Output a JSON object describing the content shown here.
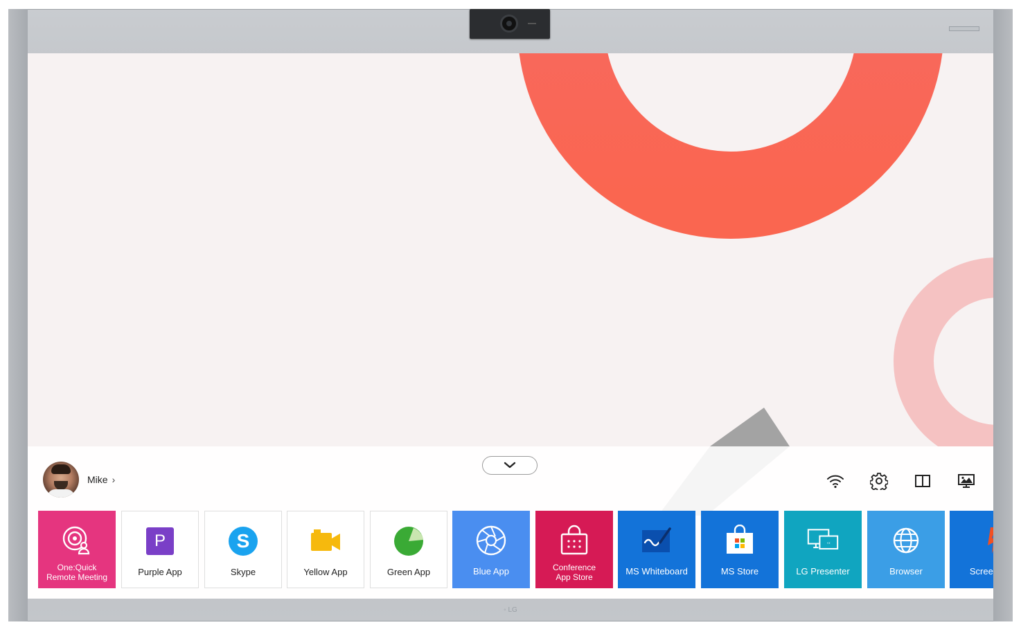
{
  "user": {
    "name": "Mike",
    "chevron": "›"
  },
  "status_icons": [
    {
      "name": "wifi-icon"
    },
    {
      "name": "settings-icon"
    },
    {
      "name": "split-screen-icon"
    },
    {
      "name": "screen-share-icon"
    }
  ],
  "apps": [
    {
      "label": "One:Quick Remote Meeting",
      "line1": "One:Quick",
      "line2": "Remote Meeting",
      "color": "#e5357f",
      "icon": "meeting-icon"
    },
    {
      "label": "Purple App",
      "color": "#ffffff",
      "icon": "purple-p-icon",
      "icon_text": "P"
    },
    {
      "label": "Skype",
      "color": "#ffffff",
      "icon": "skype-icon",
      "icon_text": "S"
    },
    {
      "label": "Yellow App",
      "color": "#ffffff",
      "icon": "video-camera-icon"
    },
    {
      "label": "Green App",
      "color": "#ffffff",
      "icon": "green-circle-icon"
    },
    {
      "label": "Blue App",
      "color": "#4a8ef0",
      "icon": "aperture-icon"
    },
    {
      "label": "Conference App Store",
      "line1": "Conference",
      "line2": "App Store",
      "color": "#d61a55",
      "icon": "shopping-bag-icon"
    },
    {
      "label": "MS Whiteboard",
      "color": "#1373d9",
      "icon": "whiteboard-icon"
    },
    {
      "label": "MS Store",
      "color": "#1373d9",
      "icon": "ms-store-icon"
    },
    {
      "label": "LG Presenter",
      "color": "#10a5c0",
      "icon": "presenter-icon"
    },
    {
      "label": "Browser",
      "color": "#3b9ee6",
      "icon": "globe-icon"
    },
    {
      "label": "Screen C",
      "color": "#1373d9",
      "icon": "screen-cast-icon"
    }
  ],
  "colors": {
    "screen_bg": "#f7f2f2",
    "accent_red": "#f8645a",
    "accent_pink": "#f5c2c2",
    "accent_gray": "#a0a0a0"
  }
}
